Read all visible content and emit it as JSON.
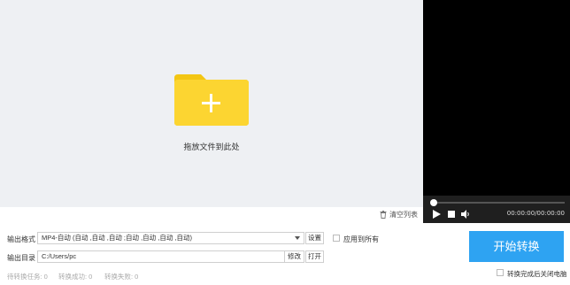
{
  "drop_zone": {
    "hint": "拖放文件到此处"
  },
  "player": {
    "time": "00:00:00/00:00:00",
    "progress": 0
  },
  "list_actions": {
    "clear_label": "清空列表"
  },
  "output_format": {
    "label": "输出格式",
    "value": "MP4-自动 (自动 ,自动 ,自动 ;自动 ,自动 ,自动 ,自动)",
    "settings_label": "设置",
    "apply_all_label": "应用到所有"
  },
  "output_dir": {
    "label": "输出目录",
    "value": "C:/Users/pc",
    "modify_label": "修改",
    "open_label": "打开"
  },
  "start_button": {
    "label": "开始转换",
    "color": "#2ea3f2"
  },
  "shutdown_label": "转换完成后关闭电脑",
  "status": {
    "pending": "待转换任务: 0",
    "success": "转换成功: 0",
    "failed": "转换失败: 0"
  },
  "icons": {
    "folder": "folder-add-icon",
    "play": "play-icon",
    "stop": "stop-icon",
    "volume": "volume-icon",
    "trash": "trash-icon"
  },
  "colors": {
    "folder": "#fcd531",
    "folder_tab": "#f3c613",
    "accent": "#2ea3f2"
  }
}
